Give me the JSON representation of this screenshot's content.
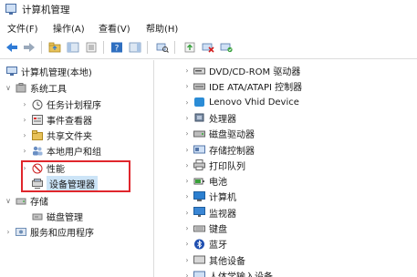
{
  "window": {
    "title": "计算机管理"
  },
  "menu": {
    "file": "文件(F)",
    "action": "操作(A)",
    "view": "查看(V)",
    "help": "帮助(H)"
  },
  "toolbar": {
    "icons": [
      "back-icon",
      "forward-icon",
      "up-folder-icon",
      "show-tree-icon",
      "properties-icon",
      "help-icon",
      "show-hide-icon",
      "scan-hardware-icon",
      "update-driver-icon",
      "uninstall-device-icon",
      "enable-device-icon"
    ]
  },
  "tree": {
    "root": "计算机管理(本地)",
    "system_tools": "系统工具",
    "task_scheduler": "任务计划程序",
    "event_viewer": "事件查看器",
    "shared_folders": "共享文件夹",
    "local_users": "本地用户和组",
    "performance": "性能",
    "device_manager": "设备管理器",
    "storage": "存储",
    "disk_management": "磁盘管理",
    "services": "服务和应用程序"
  },
  "devices": [
    {
      "label": "DVD/CD-ROM 驱动器",
      "icon": "dvd-drive-icon"
    },
    {
      "label": "IDE ATA/ATAPI 控制器",
      "icon": "ide-controller-icon"
    },
    {
      "label": "Lenovo Vhid Device",
      "icon": "hid-device-icon"
    },
    {
      "label": "处理器",
      "icon": "processor-icon"
    },
    {
      "label": "磁盘驱动器",
      "icon": "disk-drive-icon"
    },
    {
      "label": "存储控制器",
      "icon": "storage-controller-icon"
    },
    {
      "label": "打印队列",
      "icon": "printer-icon"
    },
    {
      "label": "电池",
      "icon": "battery-icon"
    },
    {
      "label": "计算机",
      "icon": "computer-icon"
    },
    {
      "label": "监视器",
      "icon": "monitor-icon"
    },
    {
      "label": "键盘",
      "icon": "keyboard-icon"
    },
    {
      "label": "蓝牙",
      "icon": "bluetooth-icon"
    },
    {
      "label": "其他设备",
      "icon": "other-devices-icon"
    },
    {
      "label": "人体学输入设备",
      "icon": "human-interface-icon"
    }
  ]
}
